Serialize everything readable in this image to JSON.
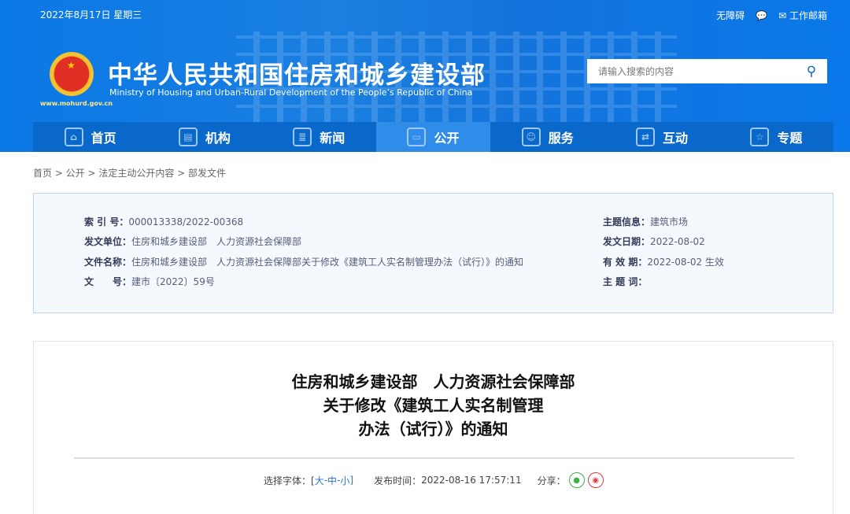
{
  "header": {
    "date": "2022年8月17日 星期三",
    "accessibility": "无障碍",
    "wechat_icon": "wechat-icon",
    "mail": "工作邮箱",
    "title": "中华人民共和国住房和城乡建设部",
    "subtitle": "Ministry of Housing and Urban-Rural Development of the People’s Republic of China",
    "site": "www.mohurd.gov.cn",
    "search_placeholder": "请输入搜索的内容"
  },
  "nav": [
    {
      "label": "首页",
      "icon": "home-icon",
      "glyph": "⌂"
    },
    {
      "label": "机构",
      "icon": "building-icon",
      "glyph": "▤"
    },
    {
      "label": "新闻",
      "icon": "news-icon",
      "glyph": "≣"
    },
    {
      "label": "公开",
      "icon": "document-icon",
      "glyph": "▭"
    },
    {
      "label": "服务",
      "icon": "service-icon",
      "glyph": "☺"
    },
    {
      "label": "互动",
      "icon": "interact-icon",
      "glyph": "⇄"
    },
    {
      "label": "专题",
      "icon": "star-icon",
      "glyph": "☆"
    }
  ],
  "breadcrumb": "首页 > 公开 > 法定主动公开内容 > 部发文件",
  "info": {
    "left": [
      {
        "label": "索 引 号：",
        "value": "000013338/2022-00368"
      },
      {
        "label": "发文单位：",
        "value": "住房和城乡建设部　人力资源社会保障部"
      },
      {
        "label": "文件名称：",
        "value": "住房和城乡建设部　人力资源社会保障部关于修改《建筑工人实名制管理办法（试行）》的通知"
      },
      {
        "label": "文　　号：",
        "value": "建市〔2022〕59号"
      }
    ],
    "right": [
      {
        "label": "主题信息：",
        "value": "建筑市场"
      },
      {
        "label": "发文日期：",
        "value": "2022-08-02"
      },
      {
        "label": "有 效 期：",
        "value": "2022-08-02 生效"
      },
      {
        "label": "主 题 词：",
        "value": ""
      }
    ]
  },
  "article": {
    "title_lines": [
      "住房和城乡建设部　人力资源社会保障部",
      "关于修改《建筑工人实名制管理",
      "办法（试行）》的通知"
    ],
    "font_label": "选择字体：[",
    "font_large": "大",
    "font_mid": "中",
    "font_small": "小",
    "sep": " - ",
    "font_close": "]",
    "publish_label": "发布时间：",
    "publish_time": "2022-08-16 17:57:11",
    "share_label": "分享："
  }
}
